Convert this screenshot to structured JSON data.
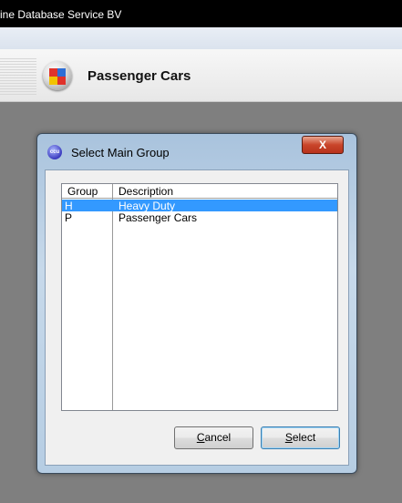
{
  "window": {
    "title": "ine Database Service BV"
  },
  "header": {
    "title": "Passenger Cars"
  },
  "dialog": {
    "title": "Select Main Group",
    "close_label": "X",
    "list": {
      "columns": [
        "Group",
        "Description"
      ],
      "rows": [
        {
          "group": "H",
          "description": "Heavy Duty",
          "selected": true
        },
        {
          "group": "P",
          "description": "Passenger Cars",
          "selected": false
        }
      ]
    },
    "buttons": {
      "cancel_mnemonic": "C",
      "cancel_rest": "ancel",
      "select_mnemonic": "S",
      "select_rest": "elect"
    }
  },
  "colors": {
    "selection": "#3399ff",
    "backdrop": "#7f7f7f",
    "close": "#c9452a"
  }
}
